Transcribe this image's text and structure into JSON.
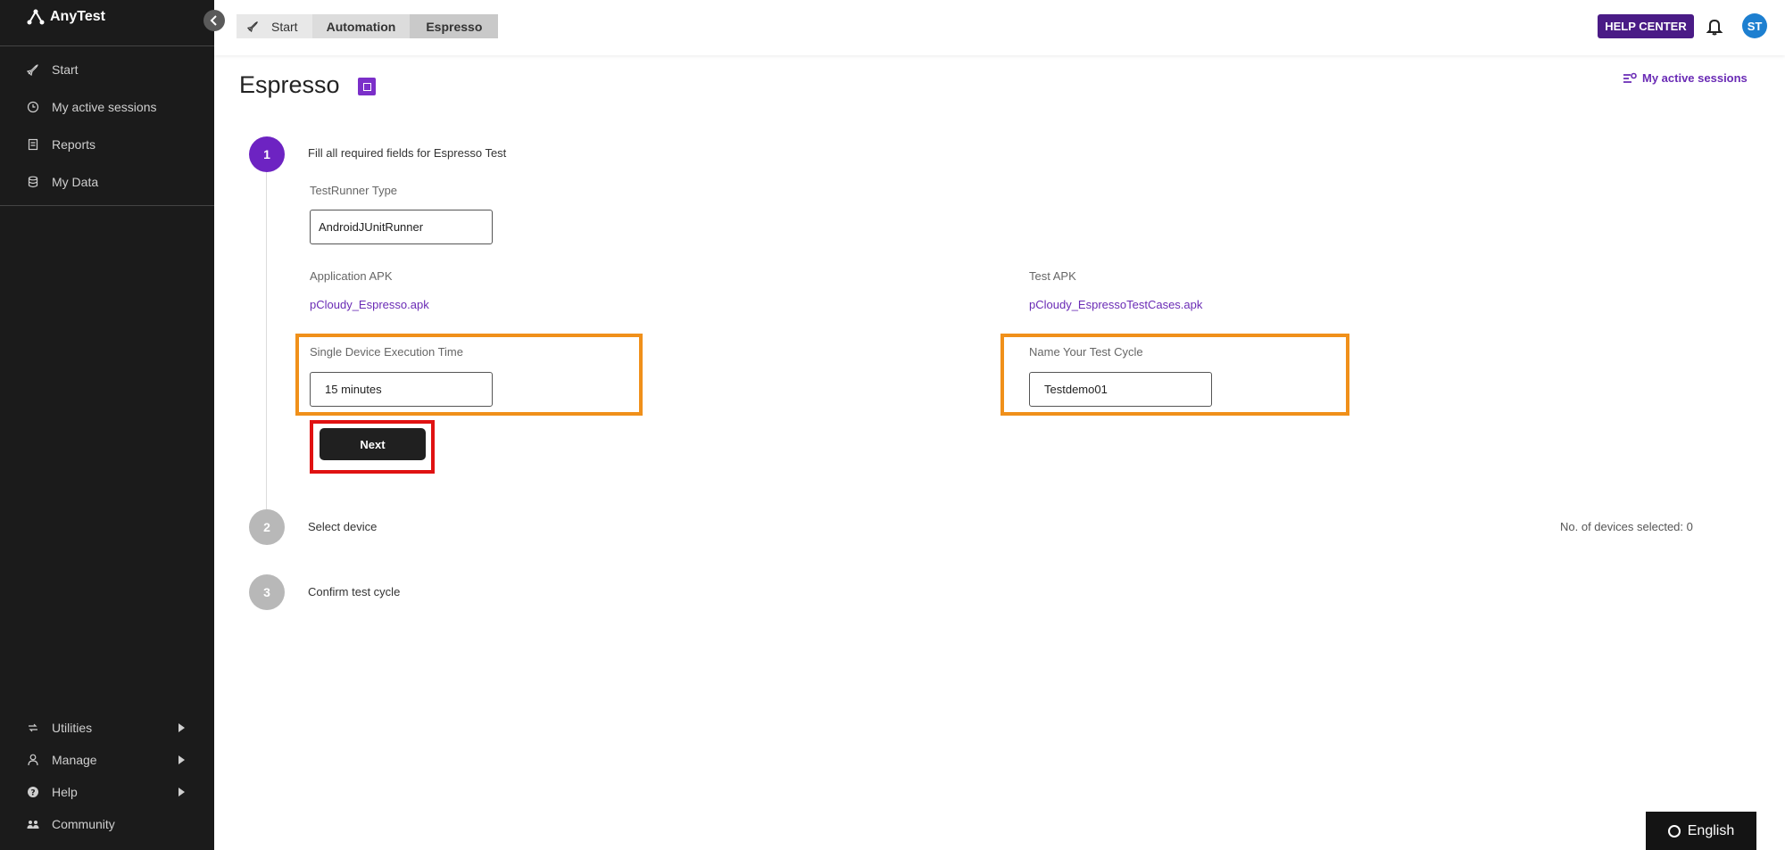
{
  "app": {
    "name": "AnyTest"
  },
  "sidebar": {
    "top_items": [
      {
        "label": "Start",
        "icon": "rocket-icon"
      },
      {
        "label": "My active sessions",
        "icon": "clock-icon"
      },
      {
        "label": "Reports",
        "icon": "report-icon"
      },
      {
        "label": "My Data",
        "icon": "database-icon"
      }
    ],
    "bottom_items": [
      {
        "label": "Utilities",
        "icon": "utilities-icon"
      },
      {
        "label": "Manage",
        "icon": "person-icon"
      },
      {
        "label": "Help",
        "icon": "help-icon"
      },
      {
        "label": "Community",
        "icon": "community-icon"
      }
    ]
  },
  "header": {
    "breadcrumbs": [
      "Start",
      "Automation",
      "Espresso"
    ],
    "help_center": "HELP CENTER",
    "avatar_initials": "ST"
  },
  "page": {
    "title": "Espresso",
    "active_sessions_link": "My active sessions"
  },
  "steps": [
    {
      "number": "1",
      "label": "Fill all required fields for Espresso Test"
    },
    {
      "number": "2",
      "label": "Select device"
    },
    {
      "number": "3",
      "label": "Confirm test cycle"
    }
  ],
  "form": {
    "testrunner_label": "TestRunner Type",
    "testrunner_value": "AndroidJUnitRunner",
    "app_apk_label": "Application APK",
    "app_apk_file": "pCloudy_Espresso.apk",
    "test_apk_label": "Test APK",
    "test_apk_file": "pCloudy_EspressoTestCases.apk",
    "exec_time_label": "Single Device Execution Time",
    "exec_time_value": "15 minutes",
    "cycle_name_label": "Name Your Test Cycle",
    "cycle_name_value": "Testdemo01",
    "next_label": "Next"
  },
  "devices_selected": "No. of devices selected: 0",
  "language": "English",
  "colors": {
    "accent": "#6d23c2",
    "help_center_bg": "#4a1b86",
    "highlight_orange": "#f0901a",
    "highlight_red": "#e01212"
  }
}
